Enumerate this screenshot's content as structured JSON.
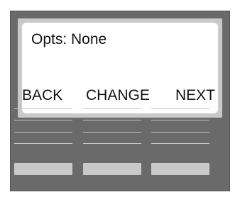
{
  "display": {
    "status_text": "Opts: None"
  },
  "softkeys": [
    {
      "label": "BACK"
    },
    {
      "label": "CHANGE"
    },
    {
      "label": "NEXT"
    }
  ],
  "colors": {
    "device_body": "#6a6a6a",
    "screen_bezel": "#c9c9c9",
    "screen_background": "#ffffff",
    "key_line": "#c4c4c4",
    "hardware_key": "#c9c9c9"
  }
}
